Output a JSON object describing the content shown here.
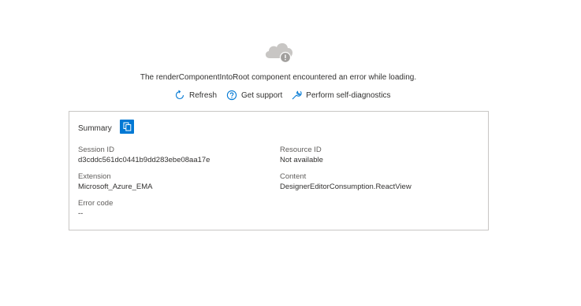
{
  "error": {
    "message": "The renderComponentIntoRoot component encountered an error while loading."
  },
  "actions": {
    "refresh": "Refresh",
    "support": "Get support",
    "diagnostics": "Perform self-diagnostics"
  },
  "summary": {
    "title": "Summary",
    "fields": {
      "session_id": {
        "label": "Session ID",
        "value": "d3cddc561dc0441b9dd283ebe08aa17e"
      },
      "resource_id": {
        "label": "Resource ID",
        "value": "Not available"
      },
      "extension": {
        "label": "Extension",
        "value": "Microsoft_Azure_EMA"
      },
      "content": {
        "label": "Content",
        "value": "DesignerEditorConsumption.ReactView"
      },
      "error_code": {
        "label": "Error code",
        "value": "--"
      }
    }
  },
  "icons": {
    "cloud": "cloud-error-icon",
    "refresh": "refresh-icon",
    "support": "help-circle-icon",
    "diagnostics": "wrench-icon",
    "copy": "copy-icon"
  },
  "colors": {
    "accent": "#0078d4",
    "link_icon": "#0078d4",
    "border": "#c8c6c4",
    "cloud": "#c8c6c4"
  }
}
